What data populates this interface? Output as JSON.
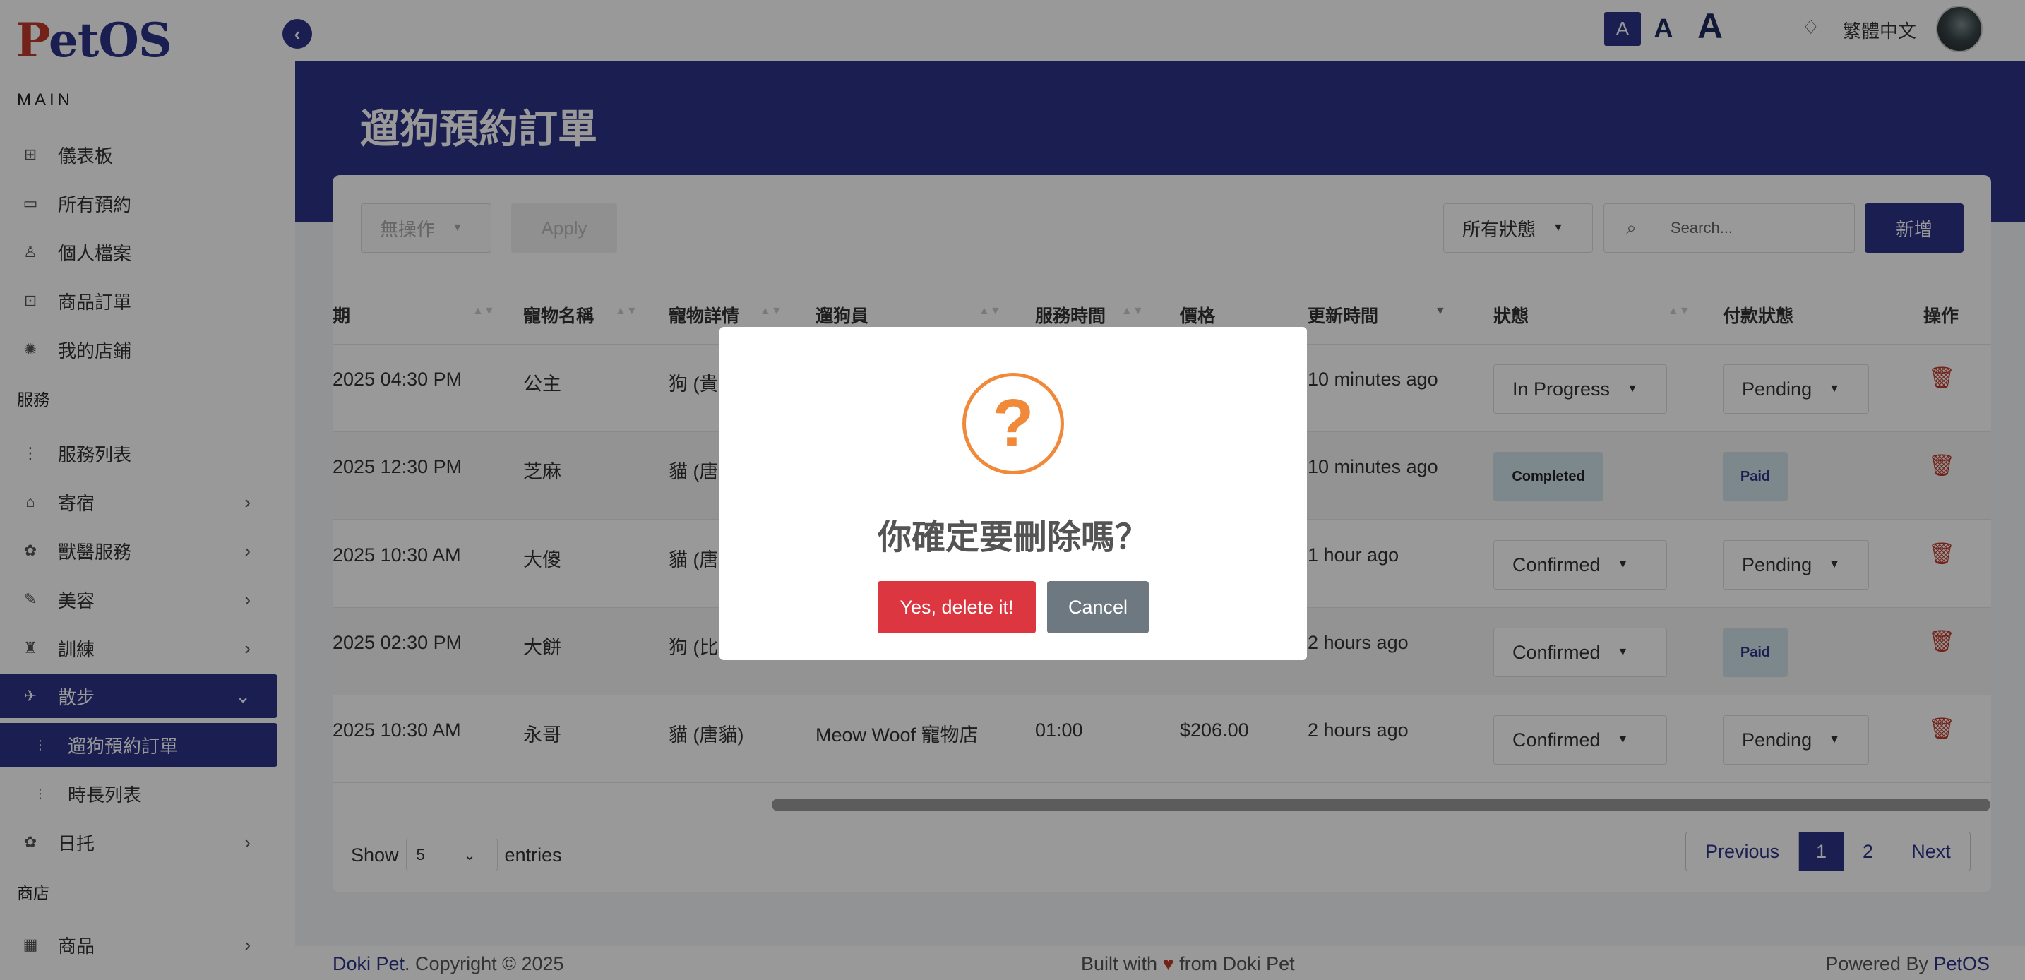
{
  "logo": {
    "first": "P",
    "rest": "etOS"
  },
  "sidebar": {
    "sections": {
      "main": "MAIN",
      "services": "服務",
      "shop": "商店"
    },
    "items": [
      {
        "label": "儀表板",
        "icon": "grid-icon"
      },
      {
        "label": "所有預約",
        "icon": "calendar-icon"
      },
      {
        "label": "個人檔案",
        "icon": "user-icon"
      },
      {
        "label": "商品訂單",
        "icon": "bag-icon"
      },
      {
        "label": "我的店鋪",
        "icon": "store-icon"
      },
      {
        "label": "服務列表",
        "icon": "list-icon"
      },
      {
        "label": "寄宿",
        "icon": "home-icon"
      },
      {
        "label": "獸醫服務",
        "icon": "vet-icon"
      },
      {
        "label": "美容",
        "icon": "scissors-icon"
      },
      {
        "label": "訓練",
        "icon": "training-icon"
      },
      {
        "label": "散步",
        "icon": "walk-icon"
      },
      {
        "label": "遛狗預約訂單",
        "icon": "list-icon"
      },
      {
        "label": "時長列表",
        "icon": "list-icon"
      },
      {
        "label": "日托",
        "icon": "daycare-icon"
      },
      {
        "label": "商品",
        "icon": "shop-icon"
      }
    ]
  },
  "topbar": {
    "font_small": "A",
    "font_medium": "A",
    "font_large": "A",
    "language": "繁體中文"
  },
  "page": {
    "title": "遛狗預約訂單"
  },
  "toolbar": {
    "bulk_action": "無操作",
    "apply": "Apply",
    "status_filter": "所有狀態",
    "search_placeholder": "Search...",
    "add": "新增"
  },
  "table": {
    "headers": [
      "期",
      "寵物名稱",
      "寵物詳情",
      "遛狗員",
      "服務時間",
      "價格",
      "更新時間",
      "狀態",
      "付款狀態",
      "操作"
    ],
    "rows": [
      {
        "date": "2025 04:30 PM",
        "pet": "公主",
        "detail": "狗 (貴...",
        "walker": "",
        "time": "",
        "price": "",
        "updated": "10 minutes ago",
        "status": "In Progress",
        "status_type": "select",
        "payment": "Pending",
        "payment_type": "select"
      },
      {
        "date": "2025 12:30 PM",
        "pet": "芝麻",
        "detail": "貓 (唐...",
        "walker": "",
        "time": "",
        "price": "",
        "updated": "10 minutes ago",
        "status": "Completed",
        "status_type": "badge",
        "payment": "Paid",
        "payment_type": "badge"
      },
      {
        "date": "2025 10:30 AM",
        "pet": "大傻",
        "detail": "貓 (唐...",
        "walker": "",
        "time": "",
        "price": "",
        "updated": "1 hour ago",
        "status": "Confirmed",
        "status_type": "select",
        "payment": "Pending",
        "payment_type": "select"
      },
      {
        "date": "2025 02:30 PM",
        "pet": "大餅",
        "detail": "狗 (比...",
        "walker": "",
        "time": "",
        "price": "",
        "updated": "2 hours ago",
        "status": "Confirmed",
        "status_type": "select",
        "payment": "Paid",
        "payment_type": "badge"
      },
      {
        "date": "2025 10:30 AM",
        "pet": "永哥",
        "detail": "貓 (唐貓)",
        "walker": "Meow Woof 寵物店",
        "time": "01:00",
        "price": "$206.00",
        "updated": "2 hours ago",
        "status": "Confirmed",
        "status_type": "select",
        "payment": "Pending",
        "payment_type": "select"
      }
    ]
  },
  "length": {
    "show": "Show",
    "value": "5",
    "entries": "entries"
  },
  "pagination": {
    "previous": "Previous",
    "page1": "1",
    "page2": "2",
    "next": "Next"
  },
  "footer": {
    "brand": "Doki Pet",
    "copyright": ". Copyright © 2025",
    "built_prefix": "Built with ",
    "built_suffix": " from Doki Pet",
    "powered_prefix": "Powered By ",
    "powered_link": "PetOS"
  },
  "modal": {
    "icon": "question-icon",
    "title": "你確定要刪除嗎？",
    "confirm": "Yes, delete it!",
    "cancel": "Cancel"
  },
  "colors": {
    "primary": "#2d3288",
    "danger": "#dc3741",
    "warning": "#f08a3a",
    "cancel": "#6e7881"
  }
}
